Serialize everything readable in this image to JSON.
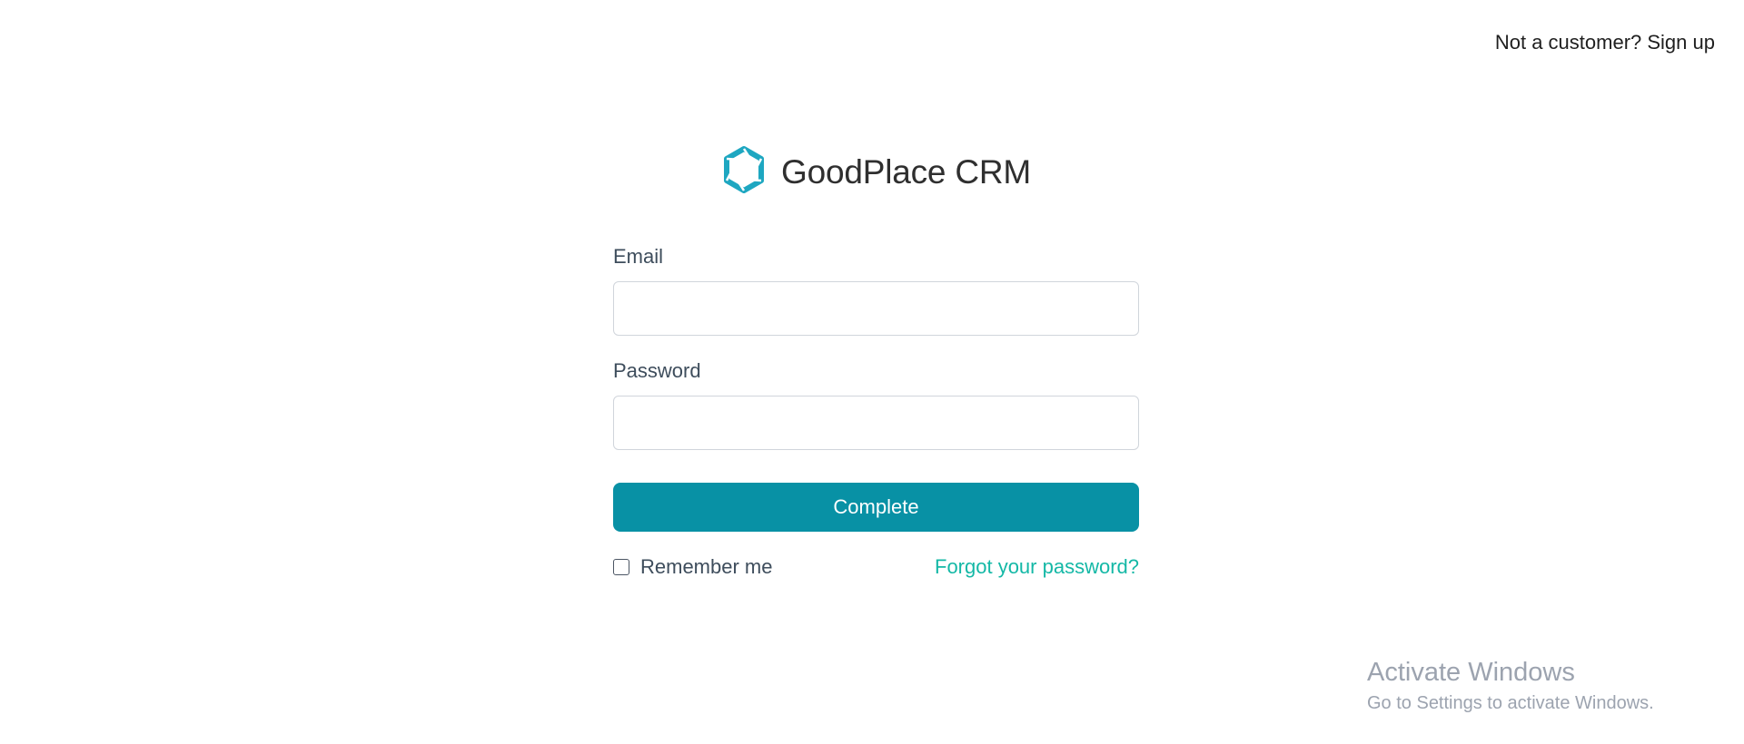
{
  "header": {
    "signup_link": "Not a customer? Sign up"
  },
  "brand": {
    "name": "GoodPlace CRM",
    "logo_icon": "hexagon-logo-icon",
    "logo_color": "#1ea7c1"
  },
  "form": {
    "email_label": "Email",
    "email_value": "",
    "password_label": "Password",
    "password_value": "",
    "submit_label": "Complete",
    "remember_label": "Remember me",
    "remember_checked": false,
    "forgot_link": "Forgot your password?"
  },
  "watermark": {
    "title": "Activate Windows",
    "subtitle": "Go to Settings to activate Windows."
  },
  "colors": {
    "primary": "#0891a5",
    "link": "#14b8a6",
    "label": "#3e4d5c"
  }
}
